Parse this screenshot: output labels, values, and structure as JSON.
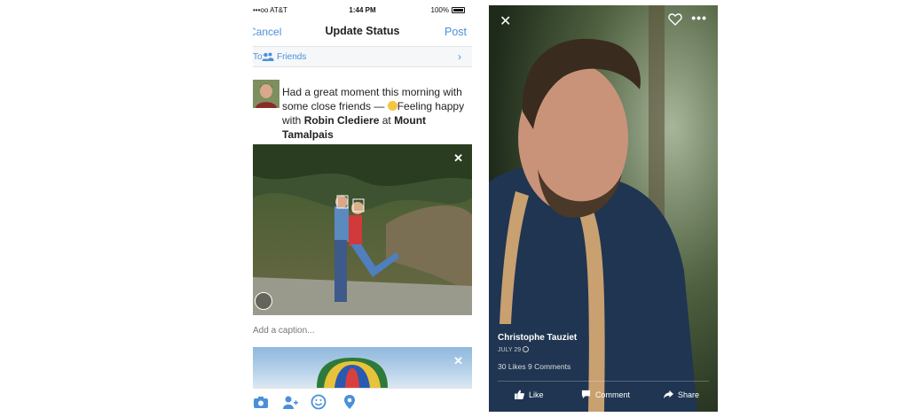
{
  "status_bar": {
    "carrier": "•••oo AT&T",
    "time": "1:44 PM",
    "battery": "100%"
  },
  "nav": {
    "cancel": "Cancel",
    "title": "Update Status",
    "post": "Post"
  },
  "audience": {
    "prefix": "To:",
    "value": "Friends"
  },
  "post": {
    "text_1": "Had a great moment this morning with some close friends — ",
    "feeling": "Feeling happy",
    "with_word": " with ",
    "tagged": "Robin Clediere",
    "at_word": " at ",
    "place": "Mount Tamalpais"
  },
  "caption": {
    "placeholder": "Add a caption..."
  },
  "bottom_bar": {
    "icons": [
      "camera-icon",
      "tag-friends-icon",
      "feeling-icon",
      "location-icon"
    ]
  },
  "viewer": {
    "name": "Christophe Tauziet",
    "date": "JULY 29",
    "stats": "30 Likes 9 Comments",
    "actions": {
      "like": "Like",
      "comment": "Comment",
      "share": "Share"
    }
  },
  "colors": {
    "link_blue": "#4a90d9",
    "text_dark": "#222222"
  }
}
